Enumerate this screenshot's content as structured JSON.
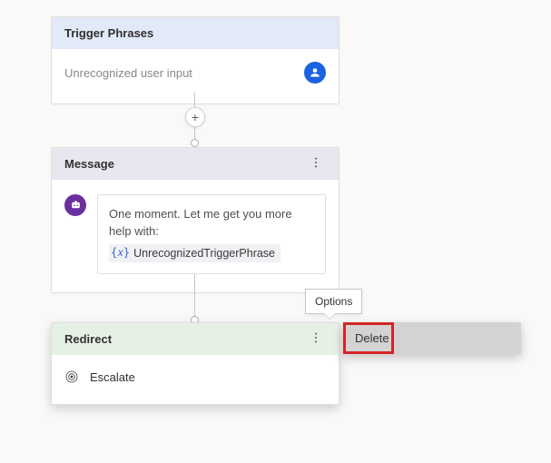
{
  "nodes": {
    "trigger": {
      "title": "Trigger Phrases",
      "input": "Unrecognized user input"
    },
    "message": {
      "title": "Message",
      "text": "One moment. Let me get you more help with:",
      "variable_icon": "{𝑥}",
      "variable_name": "UnrecognizedTriggerPhrase"
    },
    "redirect": {
      "title": "Redirect",
      "action": "Escalate"
    }
  },
  "tooltip": "Options",
  "context_menu": {
    "items": [
      "Delete"
    ]
  }
}
